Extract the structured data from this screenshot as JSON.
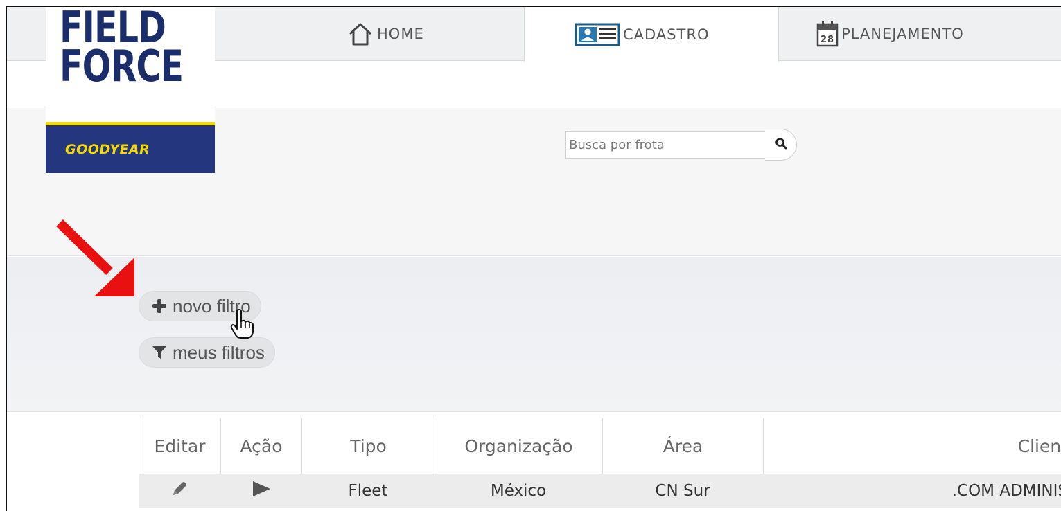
{
  "nav": {
    "tabs": [
      {
        "label": "HOME",
        "icon": "home-icon"
      },
      {
        "label": "CADASTRO",
        "icon": "id-card-icon"
      },
      {
        "label": "PLANEJAMENTO",
        "icon": "calendar-icon"
      }
    ],
    "calendar_day": "28",
    "active_tab": "CADASTRO"
  },
  "logo": {
    "line1": "FIELD",
    "line2": "FORCE",
    "brand": "GOODYEAR",
    "colors": {
      "navy": "#23367e",
      "yellow": "#f6d900"
    }
  },
  "search": {
    "placeholder": "Busca por frota",
    "button_icon": "search-icon"
  },
  "filters": {
    "new_label": "novo filtro",
    "new_icon": "plus-icon",
    "mine_label": "meus filtros",
    "mine_icon": "funnel-icon"
  },
  "table": {
    "headers": [
      "Editar",
      "Ação",
      "Tipo",
      "Organização",
      "Área",
      "Client"
    ],
    "rows": [
      {
        "edit_icon": "pencil-icon",
        "action_icon": "play-icon",
        "tipo": "Fleet",
        "organizacao": "México",
        "area": "CN Sur",
        "cliente": ".COM ADMINIS"
      }
    ]
  },
  "annotation": {
    "arrow_color": "#e8110f"
  }
}
